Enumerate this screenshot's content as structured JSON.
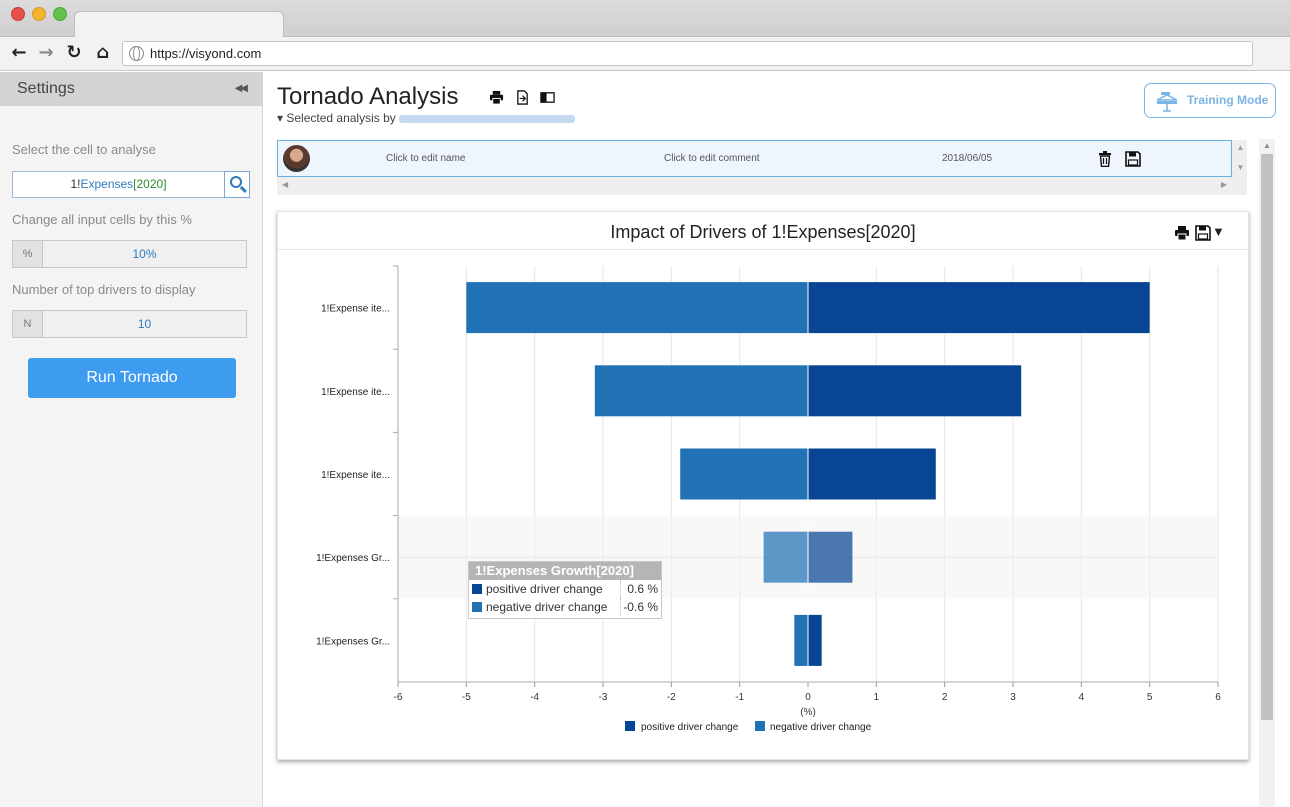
{
  "browser": {
    "url": "https://visyond.com"
  },
  "sidebar": {
    "title": "Settings",
    "cell_label": "Select the cell to analyse",
    "cell_value": {
      "sheet": "1!",
      "name": "Expenses",
      "index": "[2020]"
    },
    "change_label": "Change all input cells by this %",
    "change_addon": "%",
    "change_value": "10%",
    "top_label": "Number of top drivers to display",
    "top_addon": "N",
    "top_value": "10",
    "run_button": "Run Tornado"
  },
  "main": {
    "title": "Tornado Analysis",
    "selected_by": "Selected analysis by",
    "training_mode": "Training Mode",
    "list_row": {
      "name": "Click to edit name",
      "comment": "Click to edit comment",
      "date": "2018/06/05"
    }
  },
  "colors": {
    "positive": "#084594",
    "negative": "#2171b5",
    "accent": "#3d9bf0"
  },
  "chart_data": {
    "type": "bar",
    "orientation": "horizontal",
    "title": "Impact of Drivers of 1!Expenses[2020]",
    "xlabel": "(%)",
    "xlim": [
      -6,
      6
    ],
    "xticks": [
      -6,
      -5,
      -4,
      -3,
      -2,
      -1,
      0,
      1,
      2,
      3,
      4,
      5,
      6
    ],
    "categories": [
      "1!Expense ite...",
      "1!Expense ite...",
      "1!Expense ite...",
      "1!Expenses Gr...",
      "1!Expenses Gr..."
    ],
    "series": [
      {
        "name": "positive driver change",
        "values": [
          5.0,
          3.12,
          1.87,
          0.65,
          0.2
        ]
      },
      {
        "name": "negative driver change",
        "values": [
          -5.0,
          -3.12,
          -1.87,
          -0.65,
          -0.2
        ]
      }
    ],
    "legend": "bottom",
    "grid": true,
    "highlight_index": 3,
    "tooltip": {
      "title": "1!Expenses Growth[2020]",
      "rows": [
        {
          "label": "positive driver change",
          "value": "0.6 %"
        },
        {
          "label": "negative driver change",
          "value": "-0.6 %"
        }
      ]
    }
  }
}
